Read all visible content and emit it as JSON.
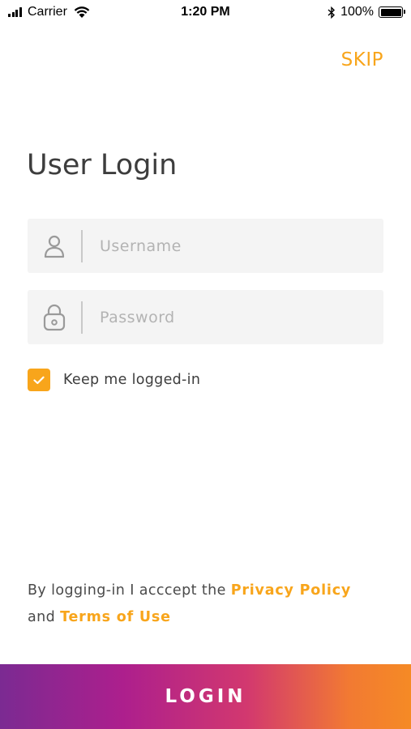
{
  "status_bar": {
    "carrier": "Carrier",
    "time": "1:20 PM",
    "battery_percent": "100%"
  },
  "header": {
    "skip_label": "SKIP"
  },
  "login": {
    "title": "User Login",
    "username_placeholder": "Username",
    "password_placeholder": "Password",
    "keep_logged_in_label": "Keep me logged-in",
    "keep_logged_in_checked": true
  },
  "terms": {
    "prefix": "By logging-in I acccept the ",
    "privacy_policy": "Privacy Policy",
    "conjunction": "and ",
    "terms_of_use": "Terms of Use"
  },
  "footer": {
    "login_label": "LOGIN"
  },
  "colors": {
    "accent": "#f8a51b",
    "text": "#3d3d3d",
    "field_bg": "#f4f4f4"
  },
  "icons": {
    "username": "user-icon",
    "password": "lock-icon",
    "checkbox": "checkmark-icon"
  }
}
